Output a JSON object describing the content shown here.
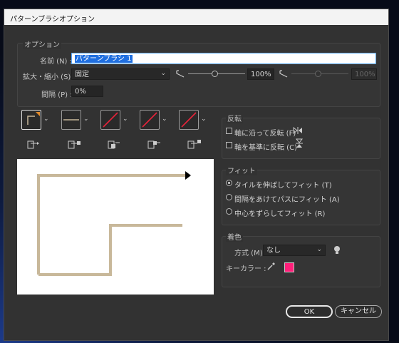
{
  "window": {
    "title": "パターンブラシオプション"
  },
  "options": {
    "legend": "オプション",
    "name_label": "名前 (N) :",
    "name_value": "パターンブラシ 1",
    "scale_label": "拡大・縮小 (S) :",
    "scale_mode": "固定",
    "scale_min_value": "100%",
    "scale_max_value": "100%",
    "spacing_label": "間隔 (P) :",
    "spacing_value": "0%"
  },
  "flip": {
    "legend": "反転",
    "along_label": "軸に沿って反転 (F)",
    "across_label": "軸を基準に反転 (C)"
  },
  "fit": {
    "legend": "フィット",
    "options": [
      "タイルを伸ばしてフィット (T)",
      "間隔をあけてパスにフィット (A)",
      "中心をずらしてフィット (R)"
    ],
    "selected_index": 0
  },
  "colorization": {
    "legend": "着色",
    "method_label": "方式 (M) :",
    "method_value": "なし",
    "key_color_label": "キーカラー :",
    "key_color": "#ff1f7a"
  },
  "buttons": {
    "ok": "OK",
    "cancel": "キャンセル"
  },
  "colors": {
    "dialog_bg": "#323232",
    "preview_path": "#c8b89a",
    "accent_blue": "#1f6fe0"
  }
}
